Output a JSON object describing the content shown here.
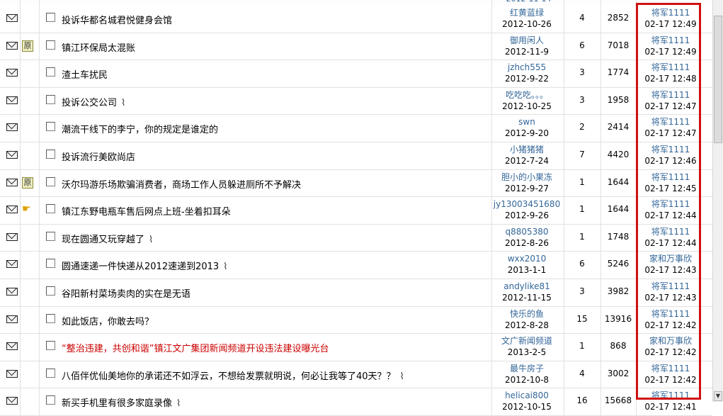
{
  "top_partial": {
    "author_stub": "2012-11-14"
  },
  "threads": [
    {
      "mail_icon": "envelope-icon",
      "badge": "",
      "title": "投诉华都名城君悦健身会馆",
      "title_color": "black",
      "attachment": false,
      "author": "红黄蓝绿",
      "post_date": "2012-10-26",
      "replies": "4",
      "views": "2852",
      "last_poster": "将军1111",
      "last_time": "02-17 12:49"
    },
    {
      "mail_icon": "envelope-icon",
      "badge": "原",
      "title": "镇江环保局太混账",
      "title_color": "black",
      "attachment": false,
      "author": "御用闲人",
      "post_date": "2012-11-9",
      "replies": "6",
      "views": "7018",
      "last_poster": "将军1111",
      "last_time": "02-17 12:49"
    },
    {
      "mail_icon": "envelope-icon",
      "badge": "",
      "title": "渣土车扰民",
      "title_color": "black",
      "attachment": false,
      "author": "jzhch555",
      "post_date": "2012-9-22",
      "replies": "3",
      "views": "1774",
      "last_poster": "将军1111",
      "last_time": "02-17 12:48"
    },
    {
      "mail_icon": "envelope-icon",
      "badge": "",
      "title": "投诉公交公司",
      "title_color": "black",
      "attachment": true,
      "author": "吃吃吃。。。",
      "post_date": "2012-10-25",
      "replies": "3",
      "views": "1958",
      "last_poster": "将军1111",
      "last_time": "02-17 12:47"
    },
    {
      "mail_icon": "envelope-icon",
      "badge": "",
      "title": "潮流干线下的李宁，你的规定是谁定的",
      "title_color": "black",
      "attachment": false,
      "author": "swn",
      "post_date": "2012-9-20",
      "replies": "2",
      "views": "2414",
      "last_poster": "将军1111",
      "last_time": "02-17 12:47"
    },
    {
      "mail_icon": "envelope-icon",
      "badge": "",
      "title": "投诉流行美欧尚店",
      "title_color": "black",
      "attachment": false,
      "author": "小猪猪猪",
      "post_date": "2012-7-24",
      "replies": "7",
      "views": "4420",
      "last_poster": "将军1111",
      "last_time": "02-17 12:46"
    },
    {
      "mail_icon": "envelope-icon",
      "badge": "原",
      "title": "沃尔玛游乐场欺骗消费者，商场工作人员躲进厕所不予解决",
      "title_color": "black",
      "attachment": false,
      "author": "胆小的小果冻",
      "post_date": "2012-9-27",
      "replies": "1",
      "views": "1644",
      "last_poster": "将军1111",
      "last_time": "02-17 12:45"
    },
    {
      "mail_icon": "envelope-icon",
      "badge": "hand",
      "title": "镇江东野电瓶车售后网点上班-坐着扣耳朵",
      "title_color": "black",
      "attachment": false,
      "author": "jy13003451680",
      "post_date": "2012-9-26",
      "replies": "1",
      "views": "1644",
      "last_poster": "将军1111",
      "last_time": "02-17 12:44"
    },
    {
      "mail_icon": "envelope-icon",
      "badge": "",
      "title": "现在圆通又玩穿越了",
      "title_color": "black",
      "attachment": true,
      "author": "q8805380",
      "post_date": "2012-8-26",
      "replies": "1",
      "views": "1748",
      "last_poster": "将军1111",
      "last_time": "02-17 12:44"
    },
    {
      "mail_icon": "envelope-icon",
      "badge": "",
      "title": "圆通速递一件快递从2012速递到2013",
      "title_color": "black",
      "attachment": true,
      "author": "wxx2010",
      "post_date": "2013-1-1",
      "replies": "6",
      "views": "5246",
      "last_poster": "家和万事欣",
      "last_time": "02-17 12:43"
    },
    {
      "mail_icon": "envelope-icon",
      "badge": "",
      "title": "谷阳新村菜场卖肉的实在是无语",
      "title_color": "black",
      "attachment": false,
      "author": "andylike81",
      "post_date": "2012-11-15",
      "replies": "3",
      "views": "3982",
      "last_poster": "将军1111",
      "last_time": "02-17 12:43"
    },
    {
      "mail_icon": "envelope-icon",
      "badge": "",
      "title": "如此饭店，你敢去吗？",
      "title_color": "black",
      "attachment": false,
      "author": "快乐的鱼",
      "post_date": "2012-8-28",
      "replies": "15",
      "views": "13916",
      "last_poster": "将军1111",
      "last_time": "02-17 12:42"
    },
    {
      "mail_icon": "envelope-icon",
      "badge": "",
      "title": "“整治违建，共创和谐”镇江文广集团新闻频道开设违法建设曝光台",
      "title_color": "red",
      "attachment": false,
      "author": "文广新闻频道",
      "post_date": "2013-2-5",
      "replies": "1",
      "views": "868",
      "last_poster": "家和万事欣",
      "last_time": "02-17 12:42"
    },
    {
      "mail_icon": "envelope-icon",
      "badge": "",
      "title": "八佰伴优仙美地你的承诺还不如浮云，不想给发票就明说，何必让我等了40天？？",
      "title_color": "black",
      "attachment": true,
      "author": "最牛房子",
      "post_date": "2012-10-8",
      "replies": "4",
      "views": "3002",
      "last_poster": "将军1111",
      "last_time": "02-17 12:42"
    },
    {
      "mail_icon": "envelope-icon",
      "badge": "",
      "title": "新买手机里有很多家庭录像",
      "title_color": "black",
      "attachment": true,
      "author": "helicai800",
      "post_date": "2012-10-15",
      "replies": "16",
      "views": "15668",
      "last_poster": "将军1111",
      "last_time": "02-17 12:41"
    }
  ],
  "colors": {
    "highlight_border": "#d01010",
    "link": "#336699",
    "red_title": "#cc0000"
  }
}
